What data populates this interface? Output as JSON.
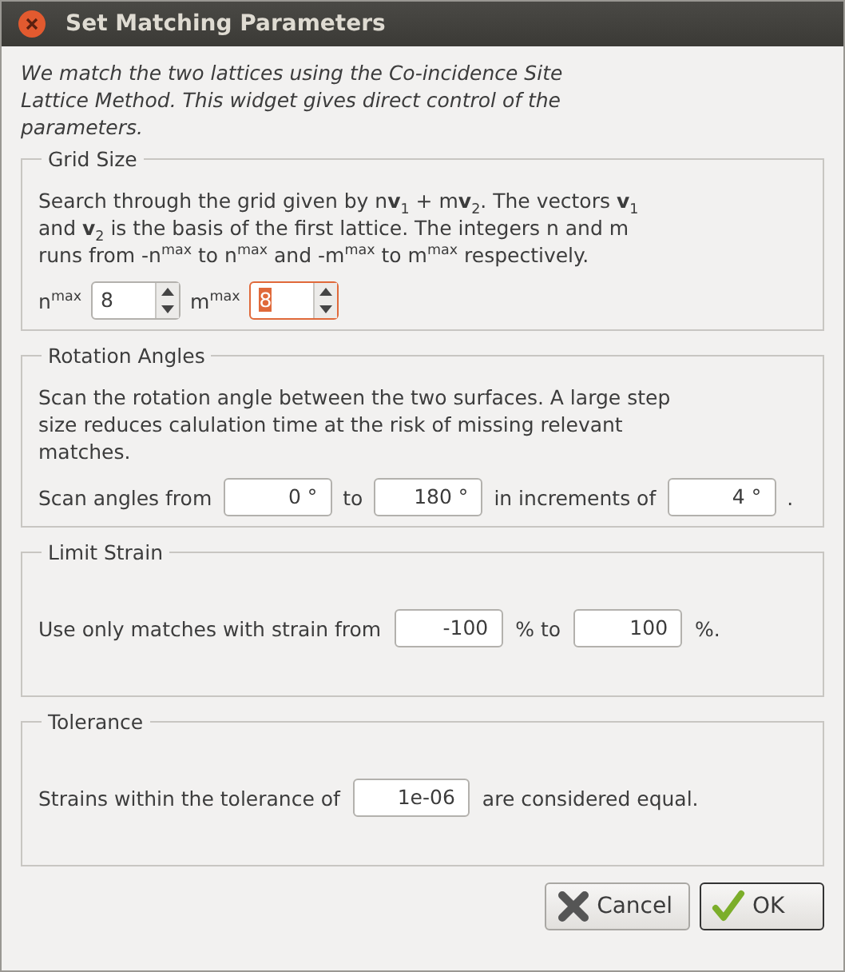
{
  "window": {
    "title": "Set Matching Parameters"
  },
  "intro": "We match the two lattices using the Co-incidence Site Lattice Method. This widget gives direct control of the parameters.",
  "groups": [
    {
      "title": "Grid Size",
      "description": "Search through the grid given by n**v**$_{1}$ + m**v**$_{2}$. The vectors **v**$_{1}$ and **v**$_{2}$ is the basis of the first lattice. The integers n and m runs from -n$^{max}$ to n$^{max}$ and -m$^{max}$ to m$^{max}$ respectively.",
      "row": [
        {
          "kind": "text",
          "text": "n$^{max}$"
        },
        {
          "kind": "spin",
          "value": "8",
          "focused": false
        },
        {
          "kind": "text",
          "text": "m$^{max}$"
        },
        {
          "kind": "spin",
          "value": "8",
          "focused": true
        }
      ]
    },
    {
      "title": "Rotation Angles",
      "description": "Scan the rotation angle between the two surfaces. A large step size reduces calulation time at the risk of missing relevant matches.",
      "row": [
        {
          "kind": "text",
          "text": "Scan angles from"
        },
        {
          "kind": "input",
          "value": "0 °"
        },
        {
          "kind": "text",
          "text": "to"
        },
        {
          "kind": "input",
          "value": "180 °"
        },
        {
          "kind": "text",
          "text": "in increments of"
        },
        {
          "kind": "input",
          "value": "4 °"
        },
        {
          "kind": "text",
          "text": "."
        }
      ]
    },
    {
      "title": "Limit Strain",
      "row": [
        {
          "kind": "text",
          "text": "Use only matches with strain from"
        },
        {
          "kind": "input",
          "value": "-100"
        },
        {
          "kind": "text",
          "text": "% to"
        },
        {
          "kind": "input",
          "value": "100"
        },
        {
          "kind": "text",
          "text": "%."
        }
      ]
    },
    {
      "title": "Tolerance",
      "row": [
        {
          "kind": "text",
          "text": "Strains within the tolerance of"
        },
        {
          "kind": "input",
          "value": "1e-06"
        },
        {
          "kind": "text",
          "text": "are considered equal."
        }
      ]
    }
  ],
  "buttons": [
    {
      "kind": "cancel",
      "label": "Cancel",
      "default": false
    },
    {
      "kind": "ok",
      "label": "OK",
      "default": true
    }
  ]
}
